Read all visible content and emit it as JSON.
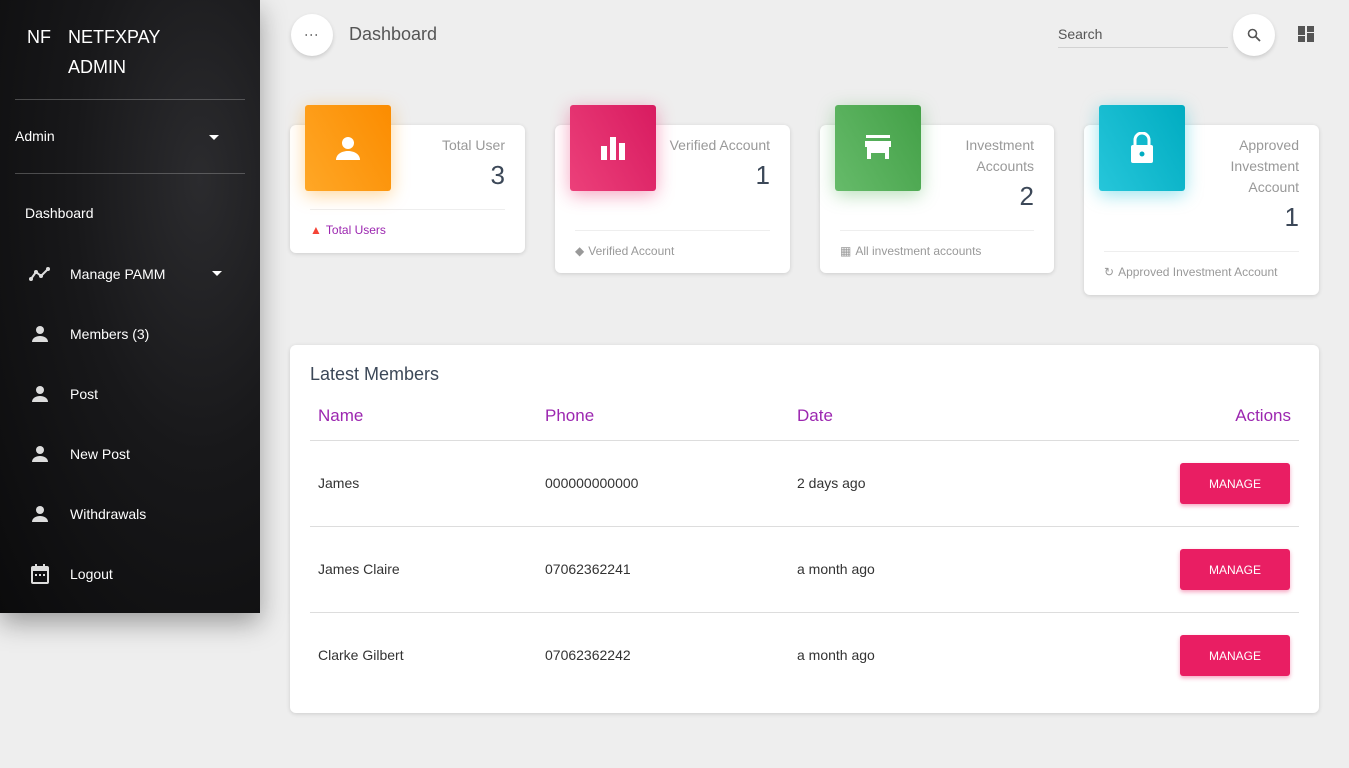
{
  "sidebar": {
    "logo_short": "NF",
    "logo_full": "NETFXPAY ADMIN",
    "user": "Admin",
    "items": [
      {
        "label": "Dashboard"
      },
      {
        "label": "Manage PAMM"
      },
      {
        "label": "Members (3)"
      },
      {
        "label": "Post"
      },
      {
        "label": "New Post"
      },
      {
        "label": "Withdrawals"
      },
      {
        "label": "Logout"
      }
    ]
  },
  "header": {
    "title": "Dashboard",
    "search_placeholder": "Search"
  },
  "cards": [
    {
      "label": "Total User",
      "value": "3",
      "footer": "Total Users",
      "color": "#fb8c00"
    },
    {
      "label": "Verified Account",
      "value": "1",
      "footer": "Verified Account",
      "color": "#d81b60"
    },
    {
      "label": "Investment Accounts",
      "value": "2",
      "footer": "All investment accounts",
      "color": "#43a047"
    },
    {
      "label": "Approved Investment Account",
      "value": "1",
      "footer": "Approved Investment Account",
      "color": "#00acc1"
    }
  ],
  "table": {
    "title": "Latest Members",
    "columns": [
      "Name",
      "Phone",
      "Date",
      "Actions"
    ],
    "rows": [
      {
        "name": "James",
        "phone": "000000000000",
        "date": "2 days ago",
        "action": "MANAGE"
      },
      {
        "name": "James Claire",
        "phone": "07062362241",
        "date": "a month ago",
        "action": "MANAGE"
      },
      {
        "name": "Clarke Gilbert",
        "phone": "07062362242",
        "date": "a month ago",
        "action": "MANAGE"
      }
    ]
  }
}
